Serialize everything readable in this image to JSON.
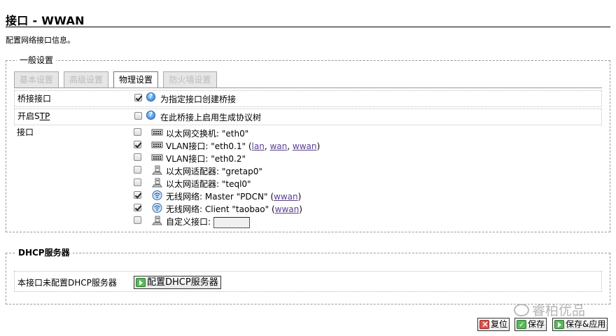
{
  "page": {
    "title": "接口 - WWAN",
    "description": "配置网络接口信息。"
  },
  "general": {
    "legend": "一般设置",
    "tabs": [
      {
        "label": "基本设置",
        "active": false
      },
      {
        "label": "高级设置",
        "active": false
      },
      {
        "label": "物理设置",
        "active": true
      },
      {
        "label": "防火墙设置",
        "active": false
      }
    ],
    "bridge": {
      "label": "桥接接口",
      "checked": true,
      "hint": "为指定接口创建桥接"
    },
    "stp": {
      "label": "开启STP",
      "checked": false,
      "hint": "在此桥接上启用生成协议树"
    },
    "interface_label": "接口",
    "interfaces": [
      {
        "checked": false,
        "icon": "ethernet-switch-icon",
        "text": "以太网交换机: \"eth0\"",
        "links": []
      },
      {
        "checked": true,
        "icon": "ethernet-switch-icon",
        "text": "VLAN接口: \"eth0.1\" (",
        "links": [
          "lan",
          "wan",
          "wwan"
        ],
        "suffix": ")"
      },
      {
        "checked": false,
        "icon": "ethernet-switch-icon",
        "text": "VLAN接口: \"eth0.2\"",
        "links": []
      },
      {
        "checked": false,
        "icon": "ethernet-adapter-icon",
        "text": "以太网适配器: \"gretap0\"",
        "links": []
      },
      {
        "checked": false,
        "icon": "ethernet-adapter-icon",
        "text": "以太网适配器: \"teql0\"",
        "links": []
      },
      {
        "checked": true,
        "icon": "wireless-icon",
        "text": "无线网络: Master \"PDCN\" (",
        "links": [
          "wwan"
        ],
        "suffix": ")"
      },
      {
        "checked": true,
        "icon": "wireless-icon",
        "text": "无线网络: Client \"taobao\" (",
        "links": [
          "wwan"
        ],
        "suffix": ")"
      },
      {
        "checked": false,
        "icon": "ethernet-adapter-icon",
        "text": "自定义接口:",
        "links": [],
        "custom_value": ""
      }
    ]
  },
  "dhcp": {
    "legend": "DHCP服务器",
    "label": "本接口未配置DHCP服务器",
    "button": "配置DHCP服务器"
  },
  "footer": {
    "reset": "复位",
    "save": "保存",
    "save_apply": "保存&应用"
  },
  "watermark": "睿柏优品",
  "colors": {
    "link": "#5a3f8f",
    "button_green": "#5cb85c",
    "button_red": "#d9534f"
  }
}
